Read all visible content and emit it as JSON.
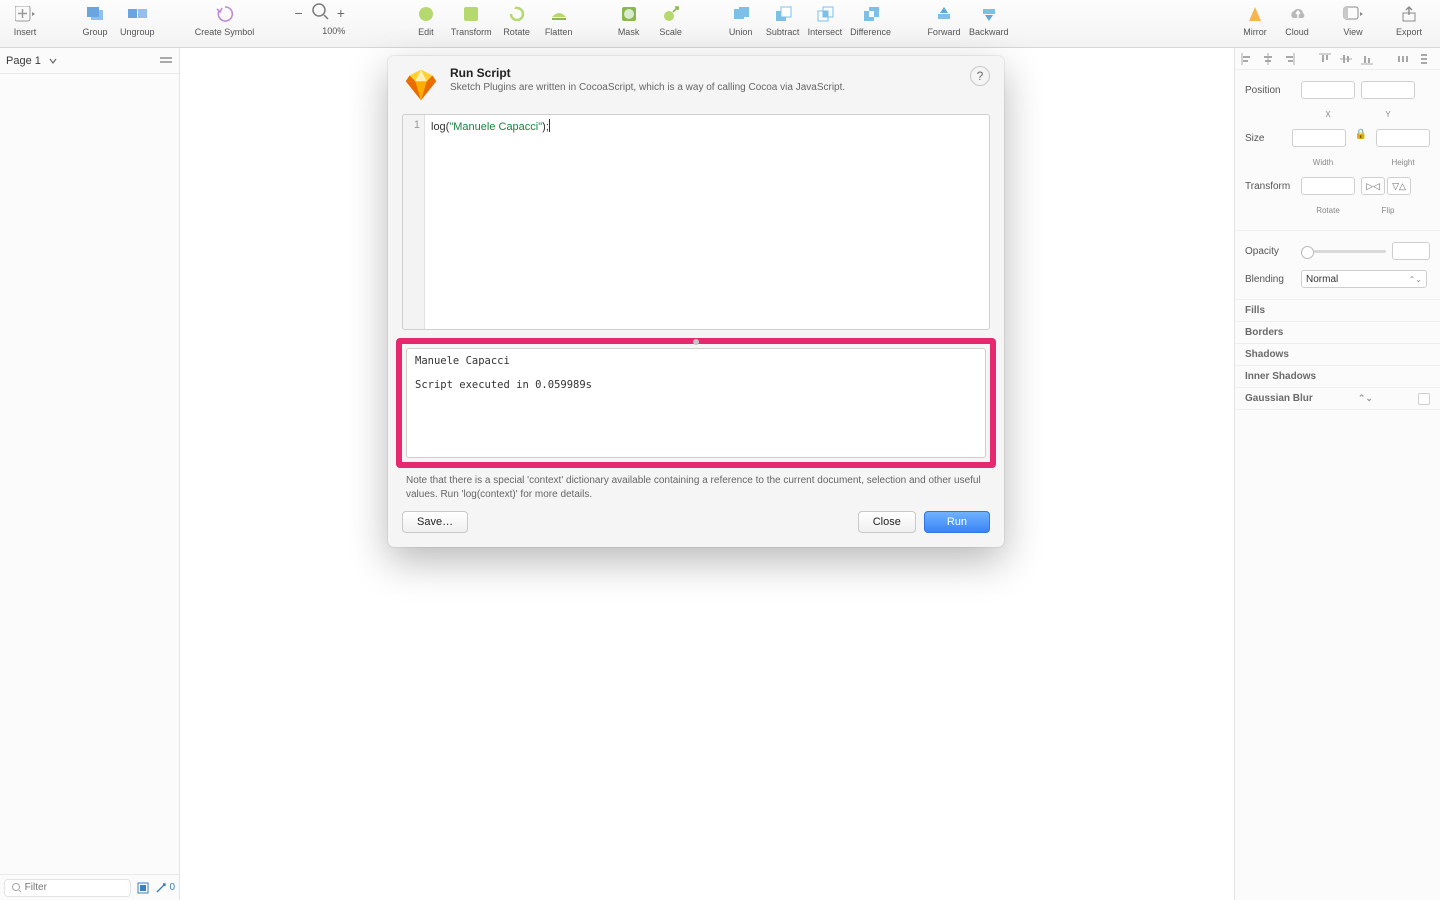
{
  "toolbar": {
    "insert": "Insert",
    "group": "Group",
    "ungroup": "Ungroup",
    "create_symbol": "Create Symbol",
    "zoom": "100%",
    "edit": "Edit",
    "transform": "Transform",
    "rotate": "Rotate",
    "flatten": "Flatten",
    "mask": "Mask",
    "scale": "Scale",
    "union": "Union",
    "subtract": "Subtract",
    "intersect": "Intersect",
    "difference": "Difference",
    "forward": "Forward",
    "backward": "Backward",
    "mirror": "Mirror",
    "cloud": "Cloud",
    "view": "View",
    "export": "Export"
  },
  "leftpanel": {
    "page": "Page 1",
    "filter_placeholder": "Filter",
    "count": "0"
  },
  "inspector": {
    "position": "Position",
    "x": "X",
    "y": "Y",
    "size": "Size",
    "width": "Width",
    "height": "Height",
    "transform": "Transform",
    "rotate": "Rotate",
    "flip": "Flip",
    "opacity": "Opacity",
    "blending": "Blending",
    "blending_value": "Normal",
    "fills": "Fills",
    "borders": "Borders",
    "shadows": "Shadows",
    "inner_shadows": "Inner Shadows",
    "gaussian_blur": "Gaussian Blur"
  },
  "dialog": {
    "title": "Run Script",
    "subtitle": "Sketch Plugins are written in CocoaScript, which is a way of calling Cocoa via JavaScript.",
    "code_line_num": "1",
    "code_prefix": "log(",
    "code_string": "\"Manuele Capacci\"",
    "code_suffix": ");",
    "output": "Manuele Capacci\n\nScript executed in 0.059989s",
    "note": "Note that there is a special 'context' dictionary available containing a reference to the current document, selection and other useful values. Run 'log(context)' for more details.",
    "save": "Save…",
    "close": "Close",
    "run": "Run"
  }
}
